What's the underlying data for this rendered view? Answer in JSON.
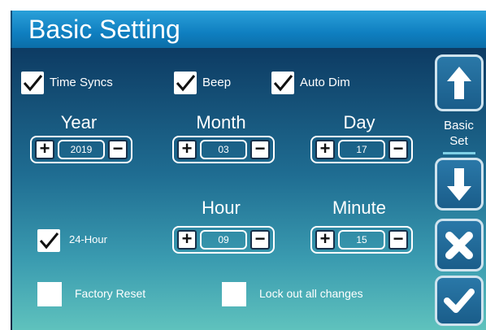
{
  "header": {
    "title": "Basic Setting"
  },
  "checkboxes": {
    "time_syncs": {
      "label": "Time Syncs",
      "checked": true
    },
    "beep": {
      "label": "Beep",
      "checked": true
    },
    "auto_dim": {
      "label": "Auto Dim",
      "checked": true
    },
    "hour_24": {
      "label": "24-Hour",
      "checked": true
    },
    "factory_reset": {
      "label": "Factory Reset",
      "checked": false
    },
    "lock_out": {
      "label": "Lock out all changes",
      "checked": false
    }
  },
  "fields": {
    "year": {
      "label": "Year",
      "value": "2019"
    },
    "month": {
      "label": "Month",
      "value": "03"
    },
    "day": {
      "label": "Day",
      "value": "17"
    },
    "hour": {
      "label": "Hour",
      "value": "09"
    },
    "minute": {
      "label": "Minute",
      "value": "15"
    }
  },
  "sidebar": {
    "label_line1": "Basic",
    "label_line2": "Set"
  },
  "icons": {
    "up": "up-arrow-icon",
    "down": "down-arrow-icon",
    "cancel": "close-icon",
    "confirm": "checkmark-icon"
  },
  "colors": {
    "title_bar": "#1a8fcf",
    "panel_top": "#0d3b63",
    "panel_bottom": "#5fc2bd"
  }
}
